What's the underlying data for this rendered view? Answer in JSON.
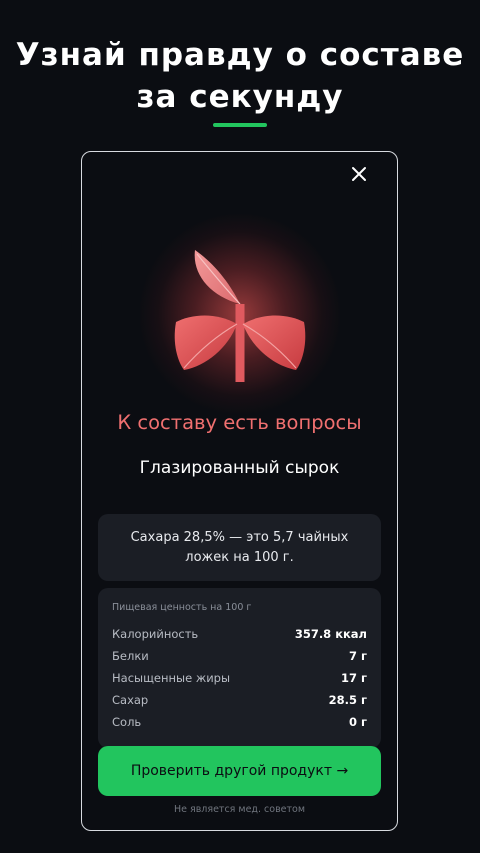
{
  "headline": {
    "line1": "Узнай правду о составе",
    "line2": "за секунду"
  },
  "colors": {
    "accent": "#22c55e",
    "warning": "#f07070",
    "background": "#0b0d12",
    "panel": "#1b1e25"
  },
  "card": {
    "close_icon": "close-icon",
    "illustration_icon": "sprout-icon",
    "verdict": "К составу есть вопросы",
    "product_name": "Глазированный сырок",
    "sugar_note": "Сахара 28,5% — это 5,7 чайных ложек на 100 г.",
    "nutrition": {
      "title": "Пищевая ценность на 100 г",
      "rows": [
        {
          "name": "Калорийность",
          "value": "357.8 ккал"
        },
        {
          "name": "Белки",
          "value": "7 г"
        },
        {
          "name": "Насыщенные жиры",
          "value": "17 г"
        },
        {
          "name": "Сахар",
          "value": "28.5 г"
        },
        {
          "name": "Соль",
          "value": "0 г"
        }
      ]
    },
    "cta_label": "Проверить другой продукт →",
    "disclaimer": "Не является мед. советом"
  }
}
